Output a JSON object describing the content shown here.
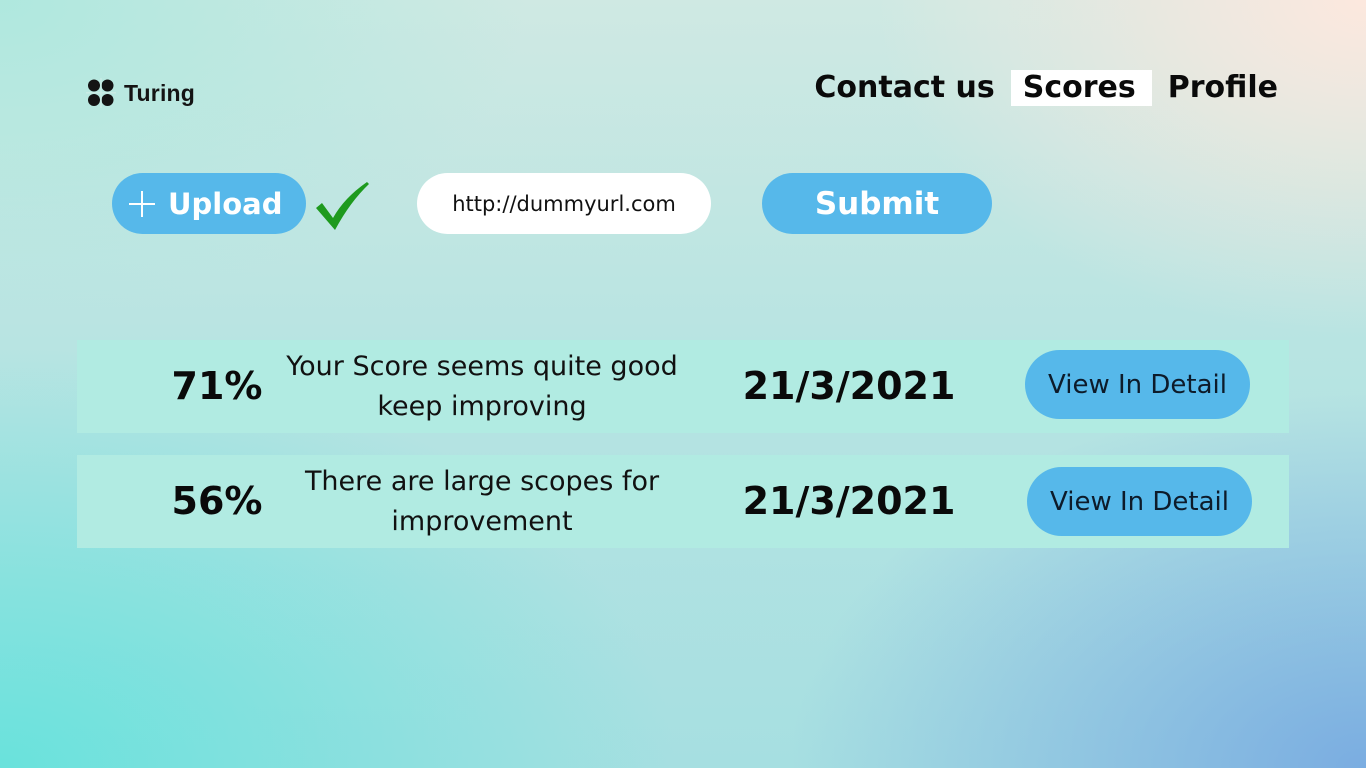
{
  "brand": {
    "name": "Turing"
  },
  "nav": {
    "items": [
      {
        "label": "Contact us",
        "active": false
      },
      {
        "label": "Scores",
        "active": true
      },
      {
        "label": "Profile",
        "active": false
      }
    ]
  },
  "actions": {
    "upload_label": "Upload",
    "upload_status": "uploaded",
    "url_value": "http://dummyurl.com",
    "submit_label": "Submit"
  },
  "scores": [
    {
      "percent": "71%",
      "message": "Your Score seems quite good keep improving",
      "date": "21/3/2021",
      "action_label": "View In Detail"
    },
    {
      "percent": "56%",
      "message": "There are large scopes for improvement",
      "date": "21/3/2021",
      "action_label": "View In Detail"
    }
  ],
  "colors": {
    "accent": "#56b8ea",
    "row_background": "#b1ebe2",
    "check": "#1e9a1e",
    "text": "#0a0a0a"
  },
  "icons": {
    "logo": "turing-logo-icon",
    "upload": "plus-icon",
    "status": "checkmark-icon"
  }
}
